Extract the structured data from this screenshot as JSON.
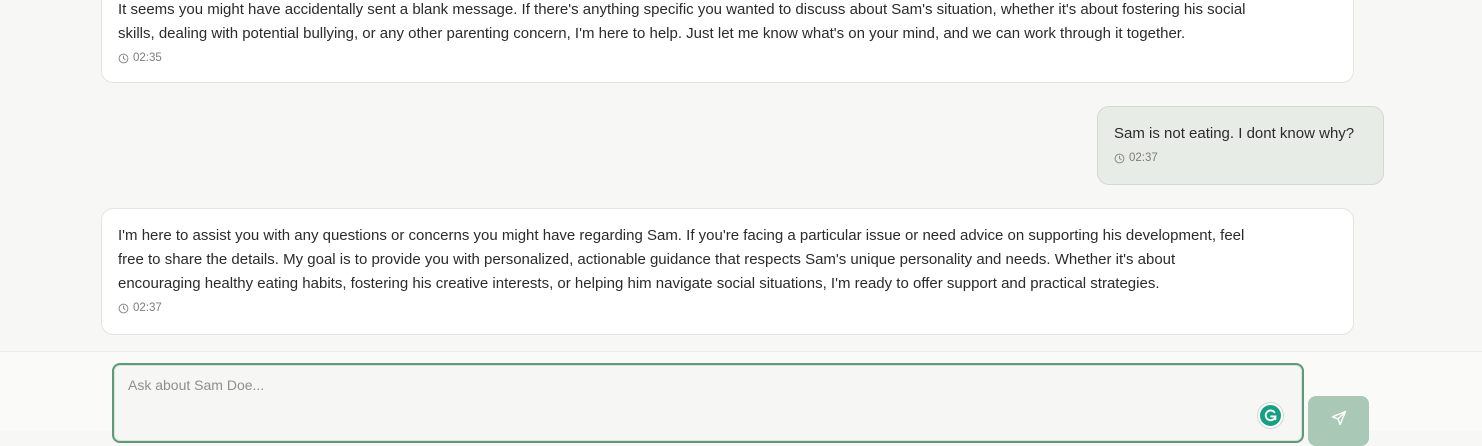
{
  "messages": [
    {
      "role": "assistant",
      "lines": [
        "It seems you might have accidentally sent a blank message. If there's anything specific you wanted to discuss about Sam's situation, whether it's about fostering his social",
        "skills, dealing with potential bullying, or any other parenting concern, I'm here to help. Just let me know what's on your mind, and we can work through it together."
      ],
      "time": "02:35"
    },
    {
      "role": "user",
      "text": "Sam is not eating. I dont know why?",
      "time": "02:37"
    },
    {
      "role": "assistant",
      "lines": [
        "I'm here to assist you with any questions or concerns you might have regarding Sam. If you're facing a particular issue or need advice on supporting his development, feel",
        "free to share the details. My goal is to provide you with personalized, actionable guidance that respects Sam's unique personality and needs. Whether it's about",
        "encouraging healthy eating habits, fostering his creative interests, or helping him navigate social situations, I'm ready to offer support and practical strategies."
      ],
      "time": "02:37"
    }
  ],
  "composer": {
    "placeholder": "Ask about Sam Doe...",
    "value": ""
  },
  "icons": {
    "timestamp": "clock-icon",
    "grammarly": "grammarly-icon",
    "send": "send-icon"
  },
  "colors": {
    "accent": "#5f9a78",
    "send_button": "#a9c8b5",
    "user_bubble": "#e8ece7",
    "grammarly": "#15a085"
  }
}
